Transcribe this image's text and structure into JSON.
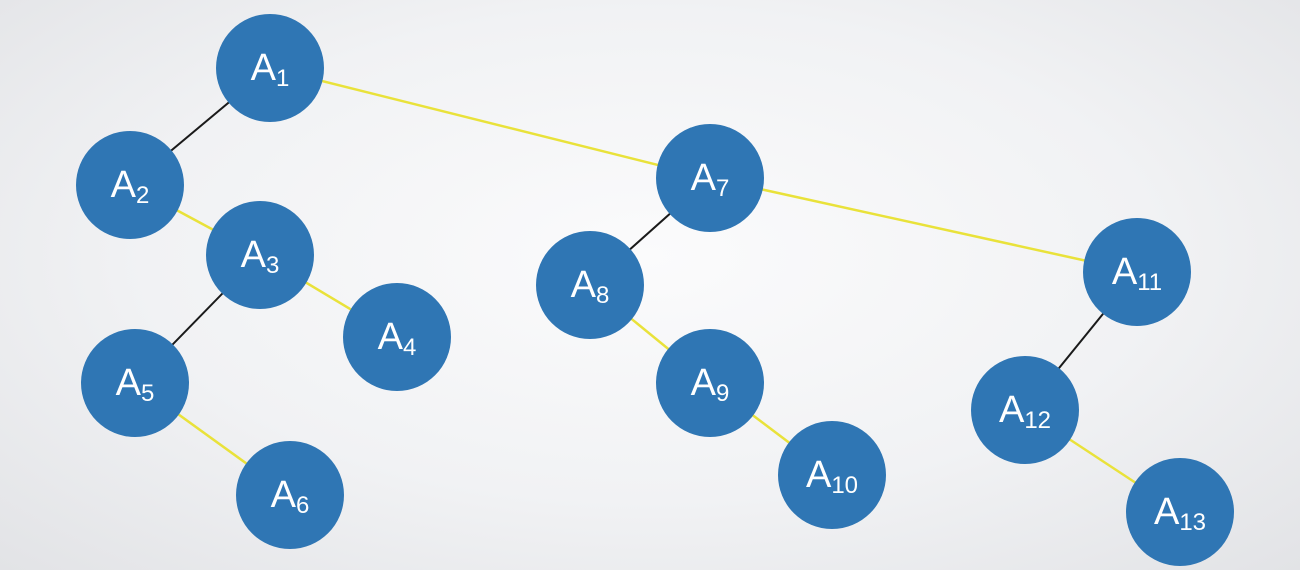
{
  "colors": {
    "node_fill": "#2f76b4",
    "label_text": "#ffffff",
    "edge_left_child": "#1a1a1a",
    "edge_right_sibling": "#e9e23a"
  },
  "nodes": [
    {
      "id": "A1",
      "letter": "A",
      "sub": "1"
    },
    {
      "id": "A2",
      "letter": "A",
      "sub": "2"
    },
    {
      "id": "A3",
      "letter": "A",
      "sub": "3"
    },
    {
      "id": "A4",
      "letter": "A",
      "sub": "4"
    },
    {
      "id": "A5",
      "letter": "A",
      "sub": "5"
    },
    {
      "id": "A6",
      "letter": "A",
      "sub": "6"
    },
    {
      "id": "A7",
      "letter": "A",
      "sub": "7"
    },
    {
      "id": "A8",
      "letter": "A",
      "sub": "8"
    },
    {
      "id": "A9",
      "letter": "A",
      "sub": "9"
    },
    {
      "id": "A10",
      "letter": "A",
      "sub": "10"
    },
    {
      "id": "A11",
      "letter": "A",
      "sub": "11"
    },
    {
      "id": "A12",
      "letter": "A",
      "sub": "12"
    },
    {
      "id": "A13",
      "letter": "A",
      "sub": "13"
    }
  ],
  "edges": [
    {
      "from": "A1",
      "to": "A2",
      "kind": "left_child"
    },
    {
      "from": "A1",
      "to": "A7",
      "kind": "right_sibling"
    },
    {
      "from": "A2",
      "to": "A3",
      "kind": "right_sibling"
    },
    {
      "from": "A3",
      "to": "A5",
      "kind": "left_child"
    },
    {
      "from": "A3",
      "to": "A4",
      "kind": "right_sibling"
    },
    {
      "from": "A5",
      "to": "A6",
      "kind": "right_sibling"
    },
    {
      "from": "A7",
      "to": "A8",
      "kind": "left_child"
    },
    {
      "from": "A7",
      "to": "A11",
      "kind": "right_sibling"
    },
    {
      "from": "A8",
      "to": "A9",
      "kind": "right_sibling"
    },
    {
      "from": "A9",
      "to": "A10",
      "kind": "right_sibling"
    },
    {
      "from": "A11",
      "to": "A12",
      "kind": "left_child"
    },
    {
      "from": "A12",
      "to": "A13",
      "kind": "right_sibling"
    }
  ]
}
